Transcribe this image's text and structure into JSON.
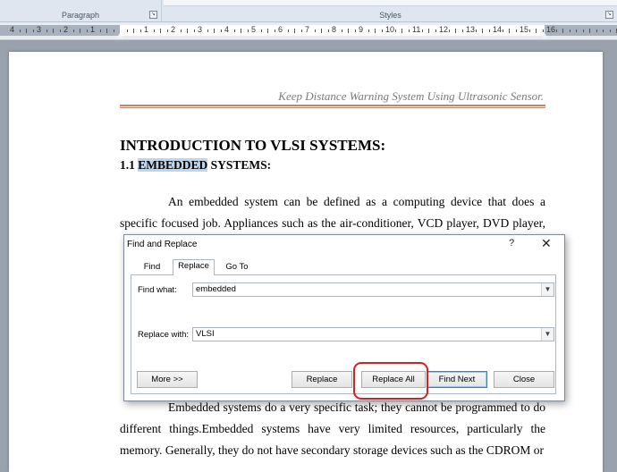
{
  "ribbon": {
    "paragraph_label": "Paragraph",
    "styles_label": "Styles"
  },
  "ruler": {
    "labels": [
      "4",
      "3",
      "2",
      "1",
      "1",
      "2",
      "3",
      "4",
      "5",
      "6",
      "7",
      "8",
      "9",
      "10",
      "11",
      "12",
      "13",
      "14",
      "15",
      "16"
    ]
  },
  "document": {
    "header": "Keep Distance Warning System Using Ultrasonic Sensor.",
    "heading1": "INTRODUCTION TO VLSI SYSTEMS:",
    "heading2_prefix": "1.1 ",
    "heading2_highlight": "EMBEDDED",
    "heading2_suffix": " SYSTEMS:",
    "para1_line1": "An embedded system can be defined as a computing device that does a",
    "para1_line2": "specific focused job. Appliances such as the air-conditioner, VCD player, DVD player,",
    "para2_line1": "Embedded systems do a very specific task; they cannot be programmed to do",
    "para2_line2": "different things.Embedded systems have very limited resources, particularly the",
    "para2_line3": "memory. Generally, they do not have secondary storage devices such as the CDROM or"
  },
  "dialog": {
    "title": "Find and Replace",
    "help": "?",
    "close": "✕",
    "tabs": [
      "Find",
      "Replace",
      "Go To"
    ],
    "active_tab": "Replace",
    "find_label": "Find what:",
    "find_value": "embedded",
    "replace_label": "Replace with:",
    "replace_value": "VLSI",
    "buttons": {
      "more": "More >>",
      "replace": "Replace",
      "replace_all": "Replace All",
      "find_next": "Find Next",
      "close": "Close"
    }
  },
  "colors": {
    "highlight_ring": "#e01c1c",
    "selection": "#bcd6ee",
    "header_rule": "#c0866a"
  }
}
